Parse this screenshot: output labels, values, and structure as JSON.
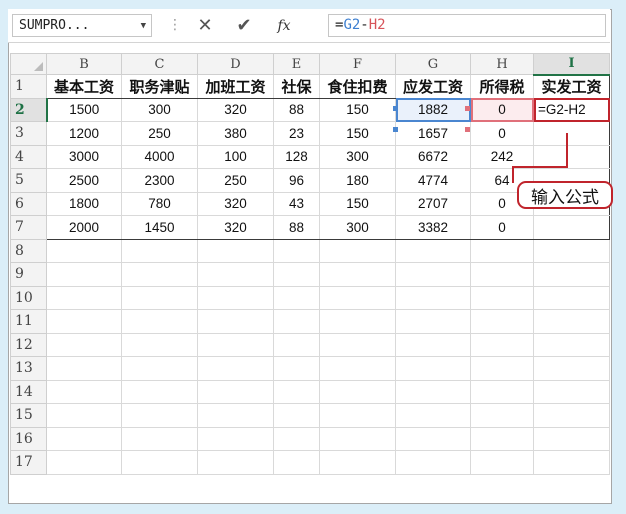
{
  "formula_bar": {
    "name_box": "SUMPRO...",
    "name_box_arrow": "▼",
    "separator": "⋮",
    "cancel_glyph": "✕",
    "enter_glyph": "✔",
    "fx_label": "fx",
    "formula_prefix": "=",
    "formula_ref1": "G2",
    "formula_minus": "-",
    "formula_ref2": "H2"
  },
  "columns": [
    "B",
    "C",
    "D",
    "E",
    "F",
    "G",
    "H",
    "I"
  ],
  "row_numbers": [
    "1",
    "2",
    "3",
    "4",
    "5",
    "6",
    "7",
    "8",
    "9",
    "10",
    "11",
    "12",
    "13",
    "14",
    "15",
    "16",
    "17"
  ],
  "headers": [
    "基本工资",
    "职务津贴",
    "加班工资",
    "社保",
    "食住扣费",
    "应发工资",
    "所得税",
    "实发工资"
  ],
  "rows": [
    [
      "1500",
      "300",
      "320",
      "88",
      "150",
      "1882",
      "0",
      "=G2-H2"
    ],
    [
      "1200",
      "250",
      "380",
      "23",
      "150",
      "1657",
      "0",
      ""
    ],
    [
      "3000",
      "4000",
      "100",
      "128",
      "300",
      "6672",
      "242",
      ""
    ],
    [
      "2500",
      "2300",
      "250",
      "96",
      "180",
      "4774",
      "64",
      ""
    ],
    [
      "1800",
      "780",
      "320",
      "43",
      "150",
      "2707",
      "0",
      ""
    ],
    [
      "2000",
      "1450",
      "320",
      "88",
      "300",
      "3382",
      "0",
      ""
    ]
  ],
  "callout": "输入公式",
  "colors": {
    "accent_green": "#217346",
    "ref_blue": "#4a86d0",
    "ref_red": "#e0707a",
    "callout_red": "#c0242c",
    "background": "#dbeef8"
  }
}
